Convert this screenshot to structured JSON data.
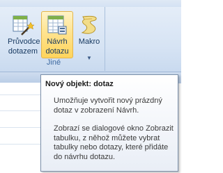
{
  "ribbon": {
    "group_label": "Jiné",
    "buttons": [
      {
        "line1": "Průvodce",
        "line2": "dotazem",
        "icon": "query-wizard-icon"
      },
      {
        "line1": "Návrh",
        "line2": "dotazu",
        "icon": "query-design-icon"
      },
      {
        "line1": "Makro",
        "icon": "macro-icon"
      }
    ]
  },
  "tooltip": {
    "title": "Nový objekt: dotaz",
    "paragraph1": "Umožňuje vytvořit nový prázdný dotaz v zobrazení Návrh.",
    "paragraph2": "Zobrazí se dialogové okno Zobrazit tabulku, z něhož můžete vybrat tabulky nebo dotazy, které přidáte do návrhu dotazu."
  },
  "colors": {
    "ribbon": "#d7e4f4",
    "selected_button": "#ffe38f",
    "group_label": "#3e6aa1"
  }
}
